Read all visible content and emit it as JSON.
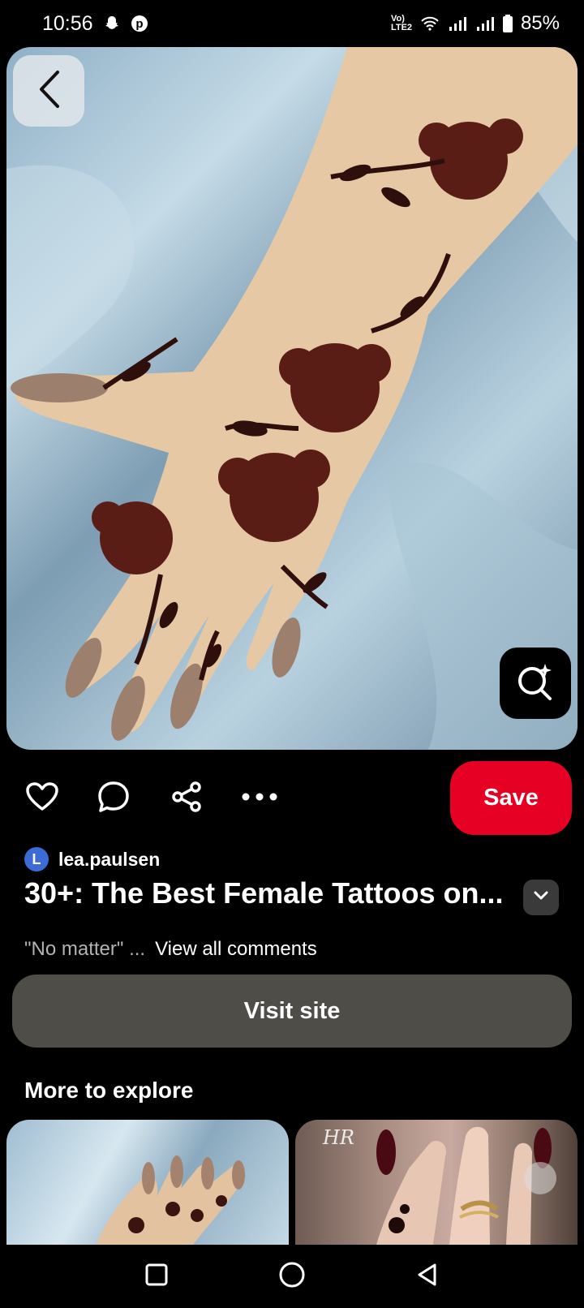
{
  "status": {
    "time": "10:56",
    "network_label": "Vo) LTE2",
    "battery": "85%"
  },
  "hero": {
    "back_icon": "chevron-left-icon",
    "lens_icon": "visual-search-icon"
  },
  "actions": {
    "like_icon": "heart-icon",
    "comment_icon": "comment-icon",
    "share_icon": "share-icon",
    "more_icon": "more-icon",
    "save_label": "Save"
  },
  "pin": {
    "author_initial": "L",
    "author_name": "lea.paulsen",
    "title": "30+: The Best Female Tattoos on...",
    "comment_snippet": "\"No matter\" ...",
    "view_comments": "View all comments",
    "visit_label": "Visit site"
  },
  "explore": {
    "heading": "More to explore",
    "thumb_2_watermark": "HR"
  },
  "colors": {
    "save": "#e60023",
    "visit": "#4e4d48",
    "avatar": "#3d6bd6"
  }
}
